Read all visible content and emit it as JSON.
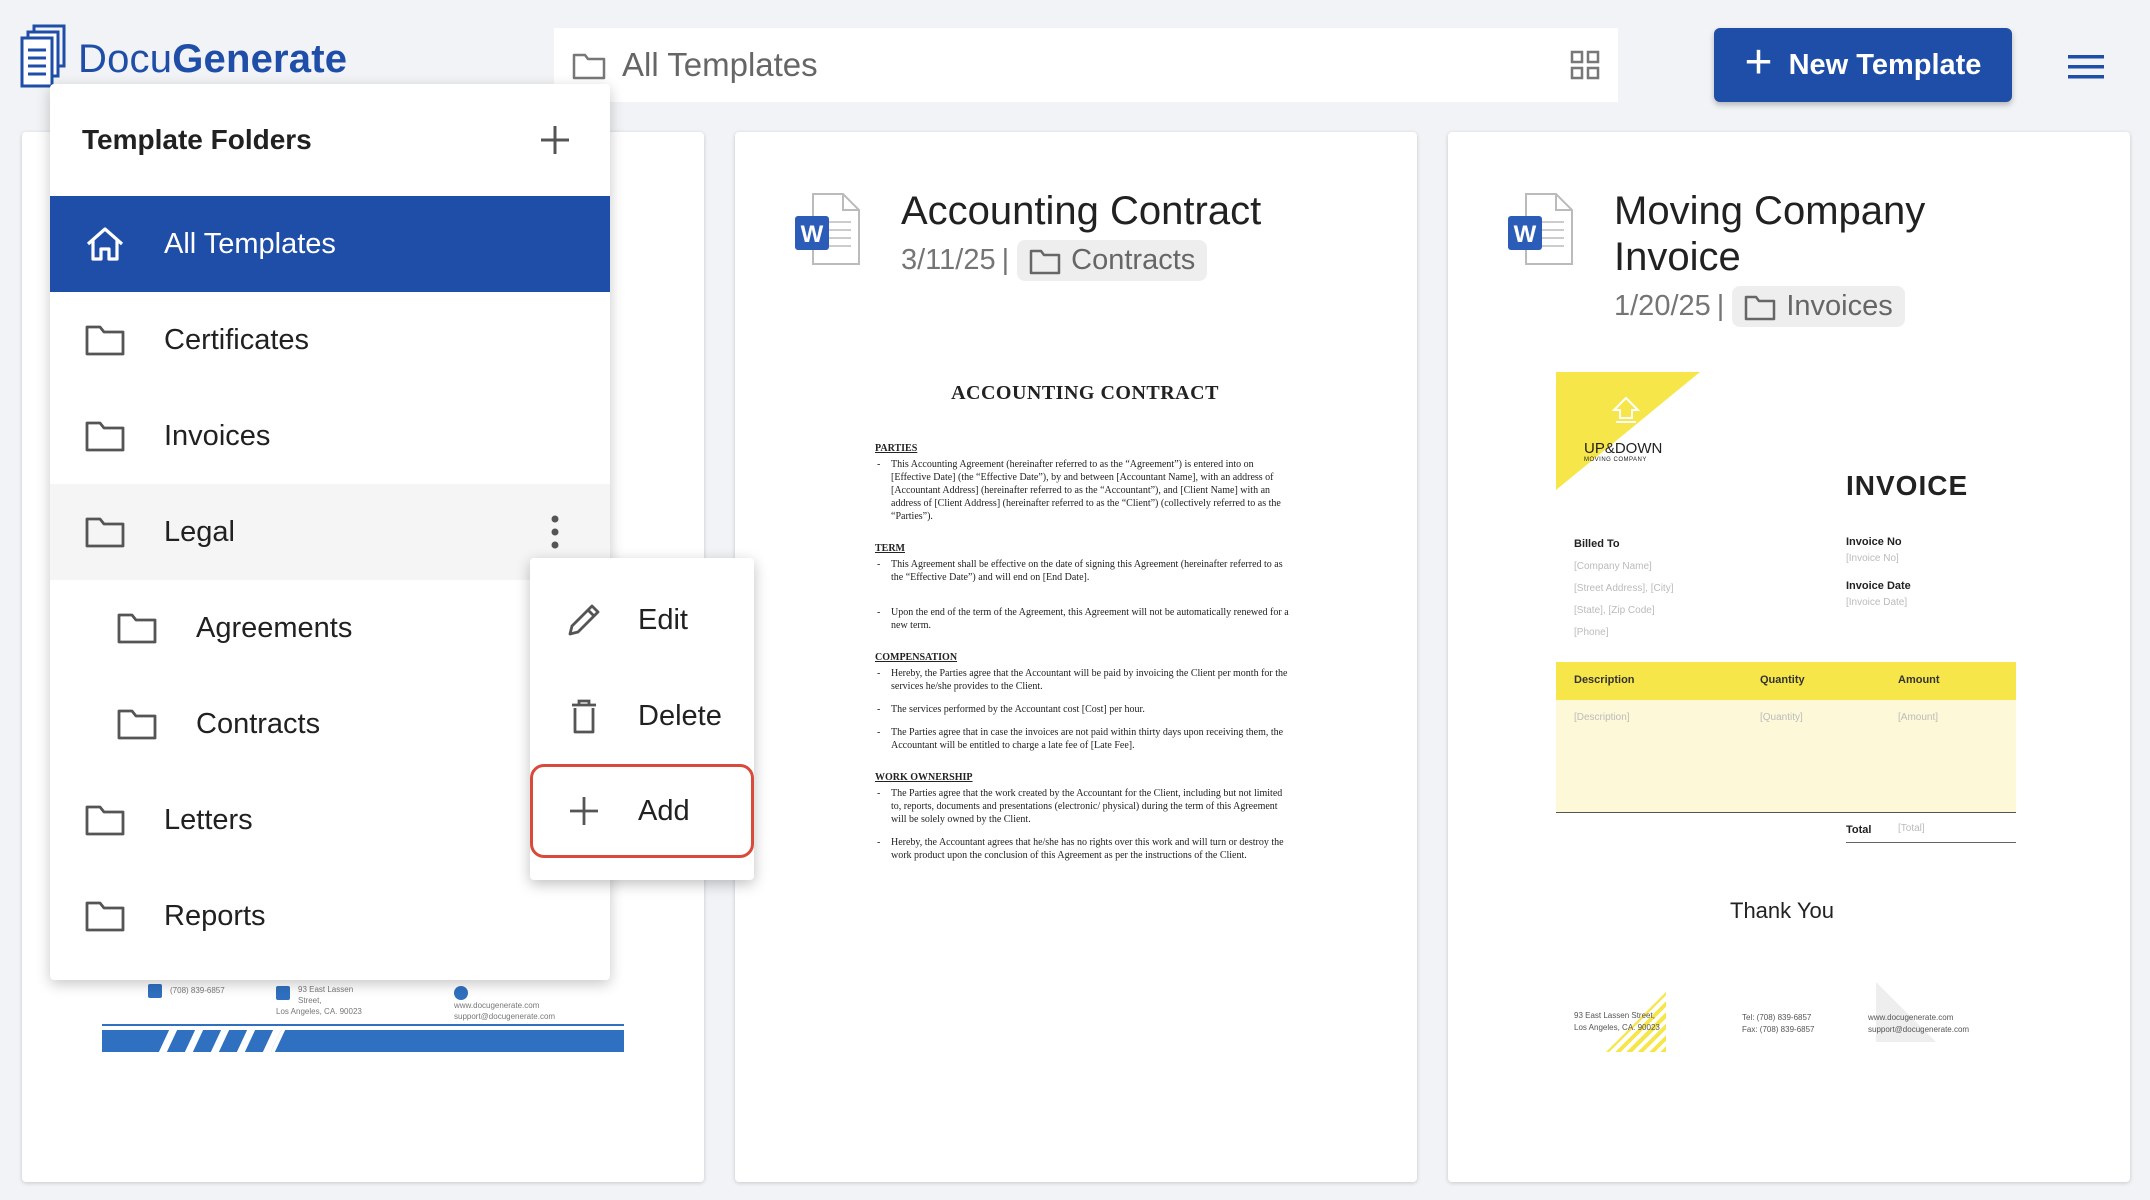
{
  "app": {
    "brand_light": "Docu",
    "brand_bold": "Generate",
    "accent": "#1f4ea8"
  },
  "search": {
    "label": "All Templates",
    "icon": "folder-icon",
    "view_toggle_icon": "grid-icon"
  },
  "toolbar": {
    "new_template_label": "New Template",
    "menu_icon": "hamburger-icon"
  },
  "folders_panel": {
    "title": "Template Folders",
    "items": [
      {
        "label": "All Templates",
        "icon": "home-icon",
        "active": true
      },
      {
        "label": "Certificates",
        "icon": "folder-icon"
      },
      {
        "label": "Invoices",
        "icon": "folder-icon"
      },
      {
        "label": "Legal",
        "icon": "folder-icon",
        "hover": true
      },
      {
        "label": "Agreements",
        "icon": "folder-icon",
        "nested": true
      },
      {
        "label": "Contracts",
        "icon": "folder-icon",
        "nested": true
      },
      {
        "label": "Letters",
        "icon": "folder-icon"
      },
      {
        "label": "Reports",
        "icon": "folder-icon"
      }
    ]
  },
  "context_menu": {
    "items": [
      {
        "label": "Edit",
        "icon": "pencil-icon"
      },
      {
        "label": "Delete",
        "icon": "trash-icon"
      },
      {
        "label": "Add",
        "icon": "plus-icon",
        "highlighted": true,
        "highlight_color": "#d84a3a"
      }
    ]
  },
  "cards": [
    {
      "title": "Accounting Contract",
      "date": "3/11/25",
      "separator": "|",
      "folder": "Contracts",
      "preview": {
        "heading": "ACCOUNTING CONTRACT",
        "sections": [
          {
            "h": "PARTIES",
            "paras": [
              "This Accounting Agreement (hereinafter referred to as the “Agreement”) is entered into on [Effective Date] (the “Effective Date”), by and between [Accountant Name], with an address of [Accountant Address] (hereinafter referred to as the “Accountant”), and [Client Name] with an address of [Client Address] (hereinafter referred to as the “Client”) (collectively referred to as the “Parties”)."
            ]
          },
          {
            "h": "TERM",
            "paras": [
              "This Agreement shall be effective on the date of signing this Agreement (hereinafter referred to as the “Effective Date”) and will end on [End Date].",
              "Upon the end of the term of the Agreement, this Agreement will not be automatically renewed for a new term."
            ]
          },
          {
            "h": "COMPENSATION",
            "paras": [
              "Hereby, the Parties agree that the Accountant will be paid by invoicing the Client per month for the services he/she provides to the Client.",
              "The services performed by the Accountant cost [Cost] per hour.",
              "The Parties agree that in case the invoices are not paid within thirty days upon receiving them, the Accountant will be entitled to charge a late fee of [Late Fee]."
            ]
          },
          {
            "h": "WORK OWNERSHIP",
            "paras": [
              "The Parties agree that the work created by the Accountant for the Client, including but not limited to, reports, documents and presentations (electronic/ physical) during the term of this Agreement will be solely owned by the Client.",
              "Hereby, the Accountant agrees that he/she has no rights over this work and will turn or destroy the work product upon the conclusion of this Agreement as per the instructions of the Client."
            ]
          }
        ]
      }
    },
    {
      "title_line1": "Moving Company",
      "title_line2": "Invoice",
      "date": "1/20/25",
      "separator": "|",
      "folder": "Invoices",
      "preview": {
        "brand": "UP&DOWN",
        "brand_sub": "MOVING COMPANY",
        "heading": "INVOICE",
        "billed_to": "Billed To",
        "billed_placeholders": [
          "[Company Name]",
          "[Street Address], [City]",
          "[State], [Zip Code]",
          "[Phone]"
        ],
        "invoice_no": "Invoice No",
        "invoice_no_ph": "[Invoice No]",
        "invoice_date": "Invoice Date",
        "invoice_date_ph": "[Invoice Date]",
        "cols": [
          "Description",
          "Quantity",
          "Amount"
        ],
        "col_ph": [
          "[Description]",
          "[Quantity]",
          "[Amount]"
        ],
        "total": "Total",
        "total_ph": "[Total]",
        "thanks": "Thank You",
        "foot_addr": [
          "93 East Lassen Street,",
          "Los Angeles, CA. 90023"
        ],
        "foot_tel": [
          "Tel: (708) 839-6857",
          "Fax: (708) 839-6857"
        ],
        "foot_web": [
          "www.docugenerate.com",
          "support@docugenerate.com"
        ],
        "accent": "#f7e64a"
      }
    }
  ],
  "card1_footer": {
    "phone": "(708) 839-6857",
    "addr": [
      "93 East Lassen Street,",
      "Los Angeles, CA. 90023"
    ],
    "web": [
      "www.docugenerate.com",
      "support@docugenerate.com"
    ],
    "stripe_color": "#2f70c0"
  }
}
